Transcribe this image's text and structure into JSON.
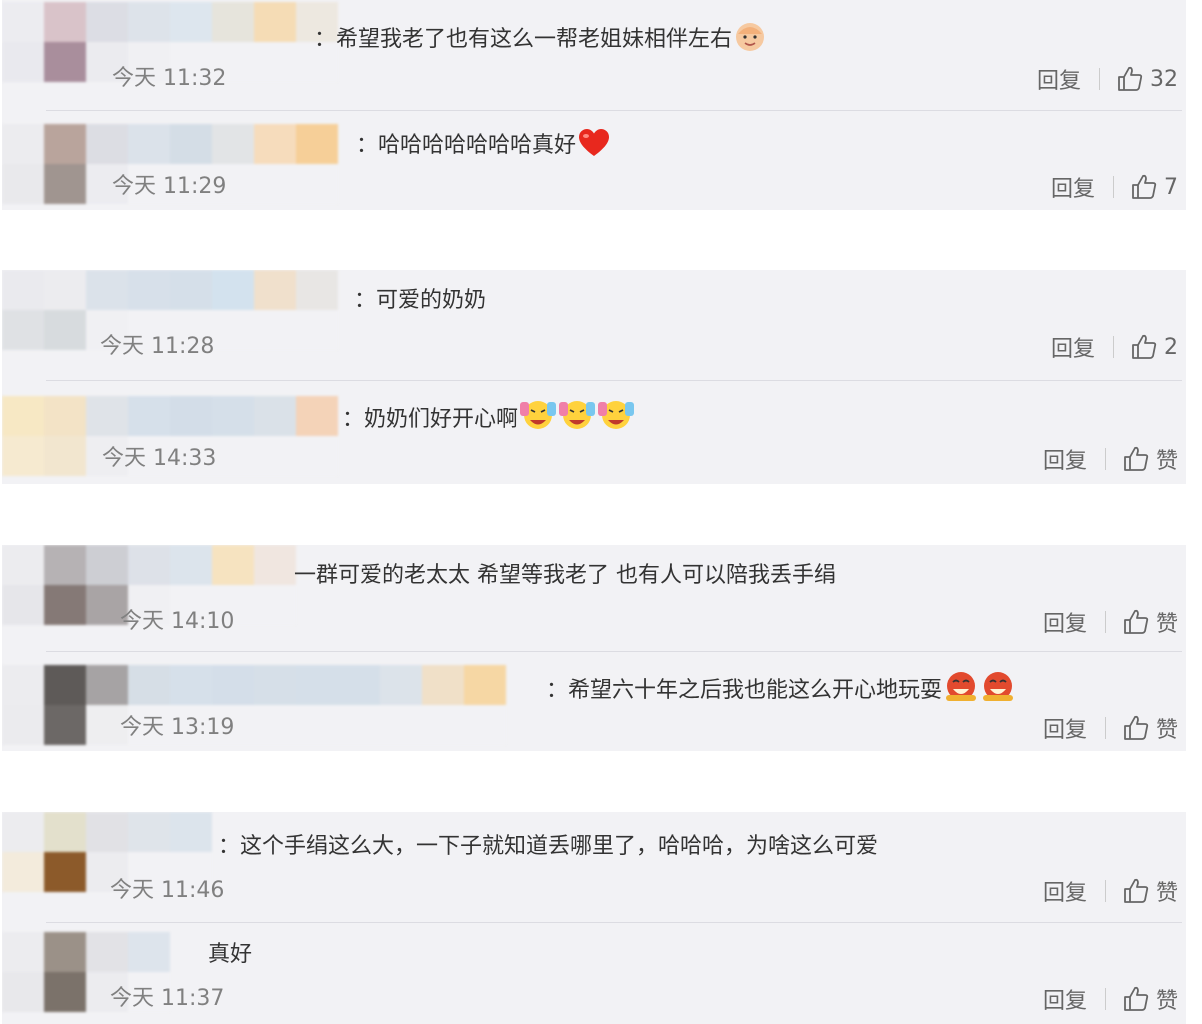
{
  "reply_label": "回复",
  "comments": [
    {
      "text": "：希望我老了也有这么一帮老姐妹相伴左右",
      "emojis": [
        "baby-emoji"
      ],
      "time": "今天 11:32",
      "likes": "32"
    },
    {
      "text": "：哈哈哈哈哈哈哈真好",
      "emojis": [
        "heart-emoji"
      ],
      "time": "今天 11:29",
      "likes": "7"
    },
    {
      "text": "：可爱的奶奶",
      "emojis": [],
      "time": "今天 11:28",
      "likes": "2"
    },
    {
      "text": "：奶奶们好开心啊",
      "emojis": [
        "cheer-emoji",
        "cheer-emoji",
        "cheer-emoji"
      ],
      "time": "今天 14:33",
      "likes": "赞"
    },
    {
      "text": "一群可爱的老太太 希望等我老了 也有人可以陪我丢手绢",
      "emojis": [],
      "time": "今天 14:10",
      "likes": "赞"
    },
    {
      "text": "：希望六十年之后我也能这么开心地玩耍",
      "emojis": [
        "laugh-emoji",
        "laugh-emoji"
      ],
      "time": "今天 13:19",
      "likes": "赞"
    },
    {
      "text": "：这个手绢这么大，一下子就知道丢哪里了，哈哈哈，为啥这么可爱",
      "emojis": [],
      "time": "今天 11:46",
      "likes": "赞"
    },
    {
      "text": "真好",
      "emojis": [],
      "time": "今天 11:37",
      "likes": "赞"
    }
  ],
  "colors": {
    "block_bg": "#f2f2f5",
    "text": "#333333",
    "muted": "#808080"
  }
}
